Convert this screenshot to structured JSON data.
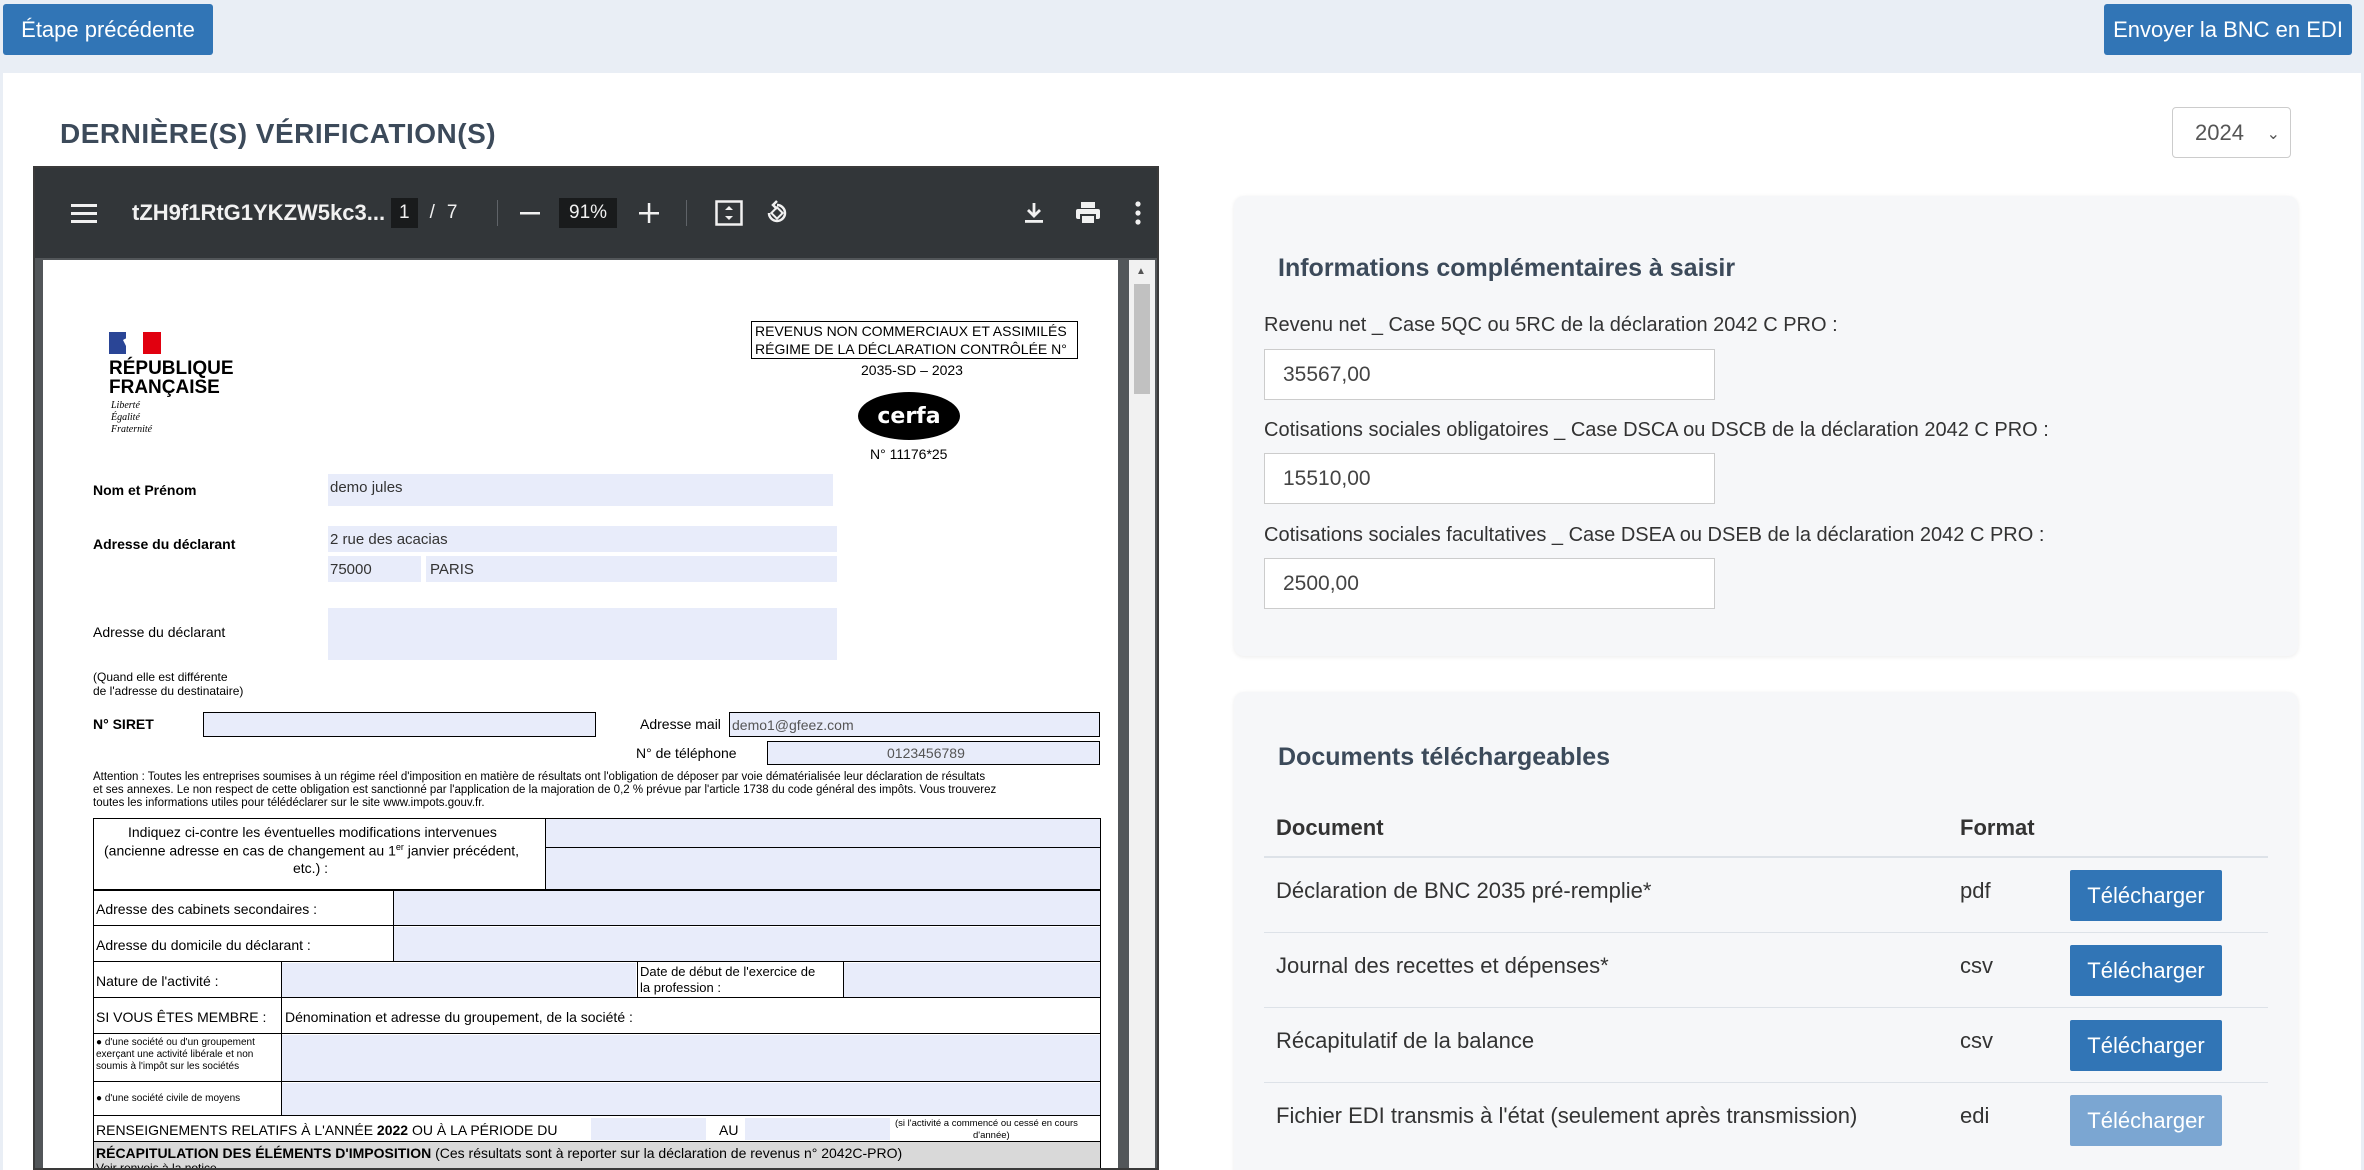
{
  "top": {
    "prev_label": "Étape précédente",
    "send_label": "Envoyer la BNC en EDI"
  },
  "section_title": "DERNIÈRE(S) VÉRIFICATION(S)",
  "year": "2024",
  "viewer": {
    "filename": "tZH9f1RtG1YKZW5kc3...",
    "page_current": "1",
    "page_sep": "/",
    "page_total": "7",
    "zoom": "91%",
    "icons": [
      "menu-icon",
      "zoom-out-icon",
      "zoom-in-icon",
      "fit-page-icon",
      "rotate-icon",
      "download-icon",
      "print-icon",
      "more-options-icon"
    ]
  },
  "form": {
    "rf_line1": "RÉPUBLIQUE",
    "rf_line2": "FRANÇAISE",
    "motto1": "Liberté",
    "motto2": "Égalité",
    "motto3": "Fraternité",
    "header1": "REVENUS NON COMMERCIAUX ET ASSIMILÉS",
    "header2": "RÉGIME DE LA DÉCLARATION CONTRÔLÉE N°",
    "form_code": "2035-SD – 2023",
    "cerfa": "cerfa",
    "cerfa_num": "N° 11176*25",
    "name_label": "Nom et Prénom",
    "name_value": "demo jules",
    "addr_label": "Adresse du déclarant",
    "addr_street": "2 rue des acacias",
    "addr_zip": "75000",
    "addr_city": "PARIS",
    "addr2_label": "Adresse du déclarant",
    "addr2_note1": "(Quand elle est différente",
    "addr2_note2": "de l'adresse du destinataire)",
    "siret_label": "N° SIRET",
    "mail_label": "Adresse mail",
    "mail_value": "demo1@gfeez.com",
    "phone_label": "N° de téléphone",
    "phone_value": "0123456789",
    "attention1": "Attention : Toutes les entreprises soumises à un régime réel d'imposition en matière de résultats ont l'obligation de déposer par voie dématérialisée leur déclaration de résultats",
    "attention2": "et ses annexes. Le non respect de cette obligation est sanctionné par l'application de la majoration de 0,2 % prévue par l'article 1738 du code général des impôts. Vous trouverez",
    "attention3": "toutes les informations utiles pour télédéclarer sur le site www.impots.gouv.fr.",
    "changes1": "Indiquez ci-contre les éventuelles modifications intervenues",
    "changes2a": "(ancienne adresse en cas de changement au 1",
    "changes2sup": "er",
    "changes2b": " janvier précédent,",
    "changes3": "etc.) :",
    "cabinets": "Adresse des cabinets secondaires :",
    "domicile": "Adresse du domicile du déclarant :",
    "nature": "Nature de l'activité :",
    "date_debut1": "Date de début de l'exercice de",
    "date_debut2": "la profession :",
    "membre": "SI VOUS ÊTES MEMBRE :",
    "denomination": "Dénomination et adresse du groupement, de la société :",
    "soc1a": "● d'une société ou d'un groupement",
    "soc1b": "exerçant une activité libérale et non",
    "soc1c": "soumis à l'impôt sur les sociétés",
    "soc2": "● d'une société civile de moyens",
    "rens_a": "RENSEIGNEMENTS RELATIFS À L'ANNÉE ",
    "rens_year": "2022",
    "rens_b": " OU À LA PÉRIODE DU",
    "rens_au": "AU",
    "rens_note1": "(si l'activité a commencé ou cessé en cours",
    "rens_note2": "d'année)",
    "recap_a": "RÉCAPITULATION DES ÉLÉMENTS D'IMPOSITION",
    "recap_b": " (Ces résultats sont à reporter sur la déclaration de revenus n° 2042C-PRO)",
    "renvois": "Voir renvois à la notice"
  },
  "info_card": {
    "title": "Informations complémentaires à saisir",
    "fields": [
      {
        "label": "Revenu net _ Case 5QC ou 5RC de la déclaration 2042 C PRO :",
        "value": "35567,00"
      },
      {
        "label": "Cotisations sociales obligatoires _ Case DSCA ou DSCB de la déclaration 2042 C PRO :",
        "value": "15510,00"
      },
      {
        "label": "Cotisations sociales facultatives _ Case DSEA ou DSEB de la déclaration 2042 C PRO :",
        "value": "2500,00"
      }
    ]
  },
  "docs_card": {
    "title": "Documents téléchargeables",
    "col_document": "Document",
    "col_format": "Format",
    "rows": [
      {
        "document": "Déclaration de BNC 2035 pré-remplie*",
        "format": "pdf",
        "action": "Télécharger"
      },
      {
        "document": "Journal des recettes et dépenses*",
        "format": "csv",
        "action": "Télécharger"
      },
      {
        "document": "Récapitulatif de la balance",
        "format": "csv",
        "action": "Télécharger"
      },
      {
        "document": "Fichier EDI transmis à l'état (seulement après transmission)",
        "format": "edi",
        "action": "Télécharger"
      }
    ]
  }
}
